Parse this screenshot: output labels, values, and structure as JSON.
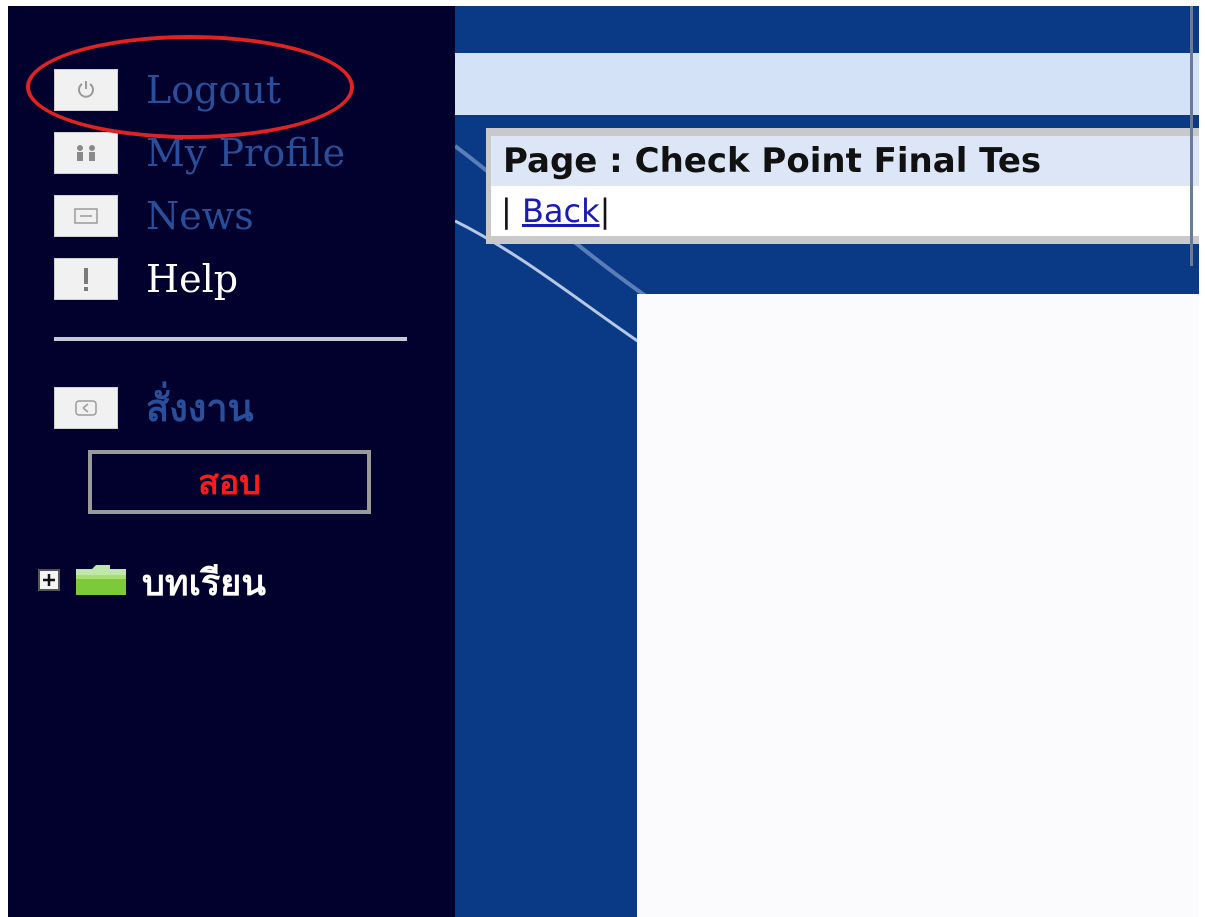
{
  "sidebar": {
    "logout": "Logout",
    "my_profile": "My Profile",
    "news": "News",
    "help": "Help",
    "assign": "สั่งงาน",
    "exam": "สอบ",
    "lessons": "บทเรียน"
  },
  "page": {
    "title": "Page : Check Point Final Tes",
    "sep_left": "| ",
    "back": "Back",
    "sep_right": "|"
  },
  "colors": {
    "sidebar_bg": "#02002c",
    "main_bg": "#0a3a86",
    "nav_blue": "#2a4f9a",
    "exam_red": "#ff1a1a",
    "highlight_ellipse": "#e02222",
    "link": "#1a1ab8"
  }
}
